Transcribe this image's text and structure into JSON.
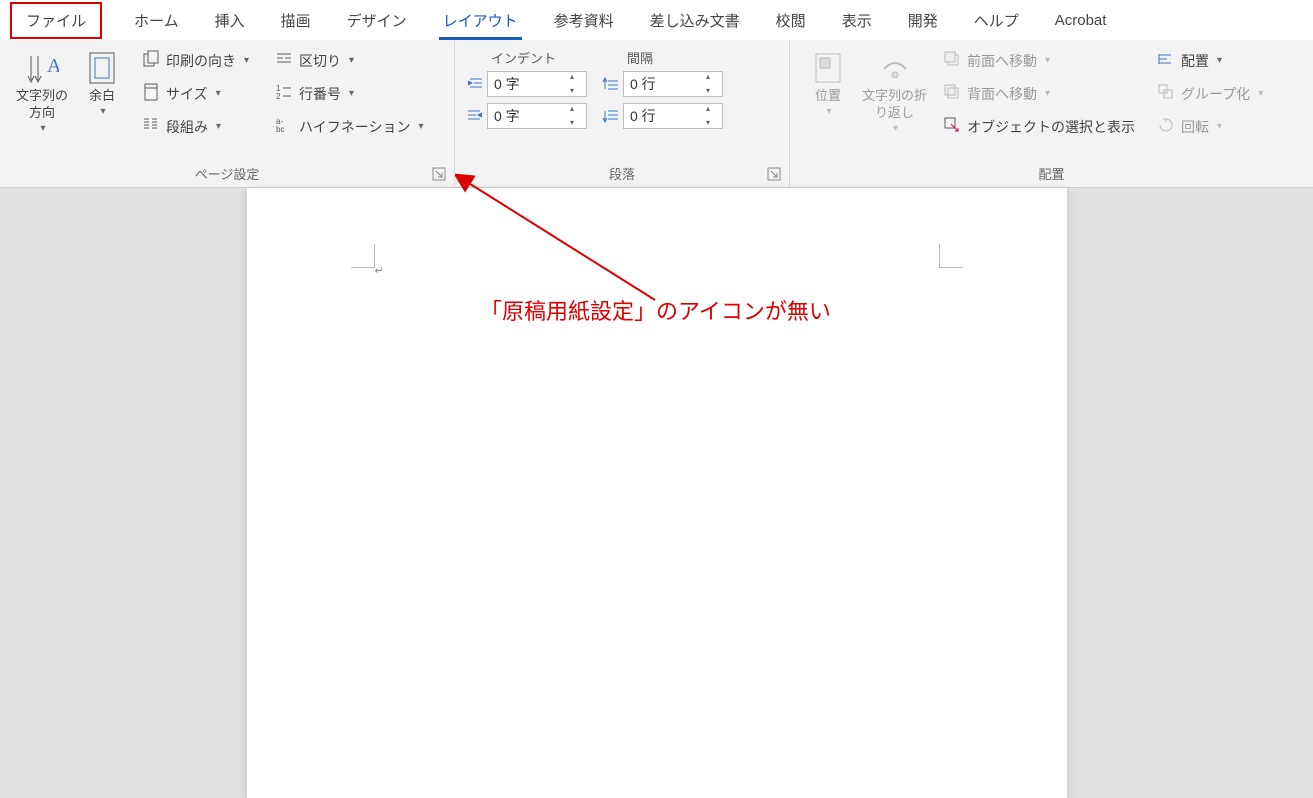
{
  "tabs": {
    "file": "ファイル",
    "home": "ホーム",
    "insert": "挿入",
    "draw": "描画",
    "design": "デザイン",
    "layout": "レイアウト",
    "references": "参考資料",
    "mailings": "差し込み文書",
    "review": "校閲",
    "view": "表示",
    "developer": "開発",
    "help": "ヘルプ",
    "acrobat": "Acrobat"
  },
  "groups": {
    "page_setup": {
      "label": "ページ設定",
      "text_direction": "文字列の\n方向",
      "margins": "余白",
      "orientation": "印刷の向き",
      "size": "サイズ",
      "columns": "段組み",
      "breaks": "区切り",
      "line_numbers": "行番号",
      "hyphenation": "ハイフネーション"
    },
    "paragraph": {
      "label": "段落",
      "indent_header": "インデント",
      "spacing_header": "間隔",
      "indent_left": "0 字",
      "indent_right": "0 字",
      "space_before": "0 行",
      "space_after": "0 行"
    },
    "arrange": {
      "label": "配置",
      "position": "位置",
      "wrap": "文字列の折\nり返し",
      "bring_forward": "前面へ移動",
      "send_backward": "背面へ移動",
      "selection_pane": "オブジェクトの選択と表示",
      "align": "配置",
      "group": "グループ化",
      "rotate": "回転"
    }
  },
  "annotation": "「原稿用紙設定」のアイコンが無い"
}
